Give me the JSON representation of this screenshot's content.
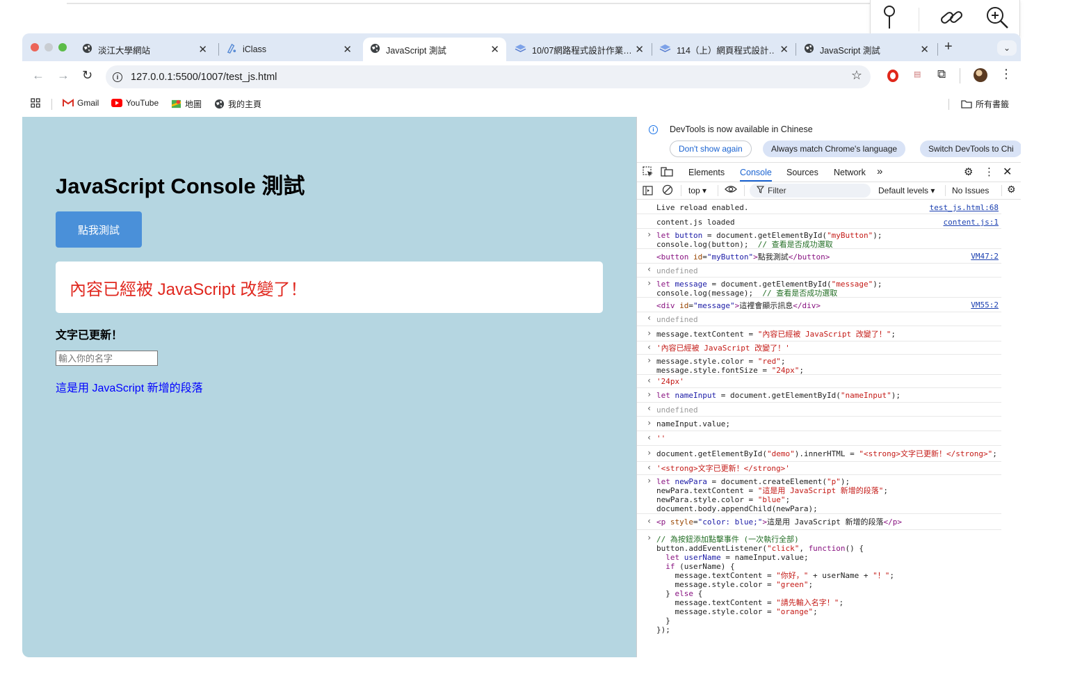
{
  "window": {
    "tabs": [
      {
        "label": "淡江大學網站",
        "icon": "globe-icon"
      },
      {
        "label": "iClass",
        "icon": "iclass-icon"
      },
      {
        "label": "JavaScript 測試",
        "icon": "globe-icon"
      },
      {
        "label": "10/07網路程式設計作業…",
        "icon": "layers-icon"
      },
      {
        "label": "114（上）網頁程式設計…",
        "icon": "layers-icon"
      },
      {
        "label": "JavaScript 測試",
        "icon": "globe-icon"
      }
    ],
    "new_tab": "+",
    "url": "127.0.0.1:5500/1007/test_js.html",
    "bookmarks": [
      "Gmail",
      "YouTube",
      "地圖",
      "我的主頁"
    ],
    "all_bookmarks": "所有書籤"
  },
  "page": {
    "heading": "JavaScript Console 測試",
    "button": "點我測試",
    "message": "內容已經被 JavaScript 改變了！",
    "demo": "文字已更新！",
    "name_placeholder": "輸入你的名字",
    "new_para": "這是用 JavaScript 新增的段落"
  },
  "devtools": {
    "banner": "DevTools is now available in Chinese",
    "btn_dont_show": "Don't show again",
    "btn_match": "Always match Chrome's language",
    "btn_switch": "Switch DevTools to Chi",
    "tabs": [
      "Elements",
      "Console",
      "Sources",
      "Network"
    ],
    "more": "»",
    "context": "top ▾",
    "filter": "Filter",
    "levels": "Default levels ▾",
    "issues": "No Issues",
    "console": {
      "l1": "Live reload enabled.",
      "l1_src": "test_js.html:68",
      "l2": "content.js loaded",
      "l2_src": "content.js:1",
      "undefined": "undefined",
      "vm47": "VM47:2",
      "vm55": "VM55:2",
      "r_msg": "'內容已經被 JavaScript 改變了！'",
      "r_px": "'24px'",
      "r_empty": "''",
      "r_strong": "'<strong>文字已更新！</strong>'",
      "in_value": "nameInput.value;"
    }
  }
}
